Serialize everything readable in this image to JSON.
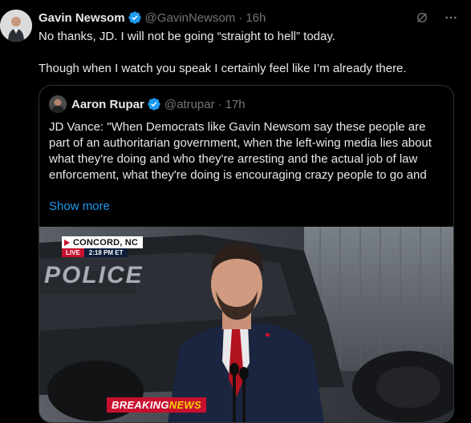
{
  "tweet": {
    "author_name": "Gavin Newsom",
    "author_handle": "@GavinNewsom",
    "separator": "·",
    "time": "16h",
    "text_line1": "No thanks, JD. I will not be going “straight to hell” today.",
    "text_line2": "Though when I watch you speak I certainly feel like I’m already there.",
    "icons": [
      "grok-icon",
      "more-icon"
    ],
    "verified_color": "#1d9bf0"
  },
  "quote": {
    "author_name": "Aaron Rupar",
    "author_handle": "@atrupar",
    "separator": "·",
    "time": "17h",
    "text": "JD Vance: \"When Democrats like Gavin Newsom say these people are part of an authoritarian government, when the left-wing media lies about what they're doing and who they're arresting and the actual job of law enforcement, what they're doing is encouraging crazy people to go and",
    "show_more": "Show more",
    "media": {
      "chyron_city": "CONCORD, NC",
      "chyron_live": "LIVE",
      "chyron_time": "2:18 PM ET",
      "police_text": "POLICE",
      "breaking_label": "BREAKING",
      "breaking_news": "NEWS"
    }
  },
  "colors": {
    "background": "#000000",
    "text": "#e7e9ea",
    "muted": "#71767b",
    "link": "#1d9bf0",
    "border": "#2f3336"
  }
}
